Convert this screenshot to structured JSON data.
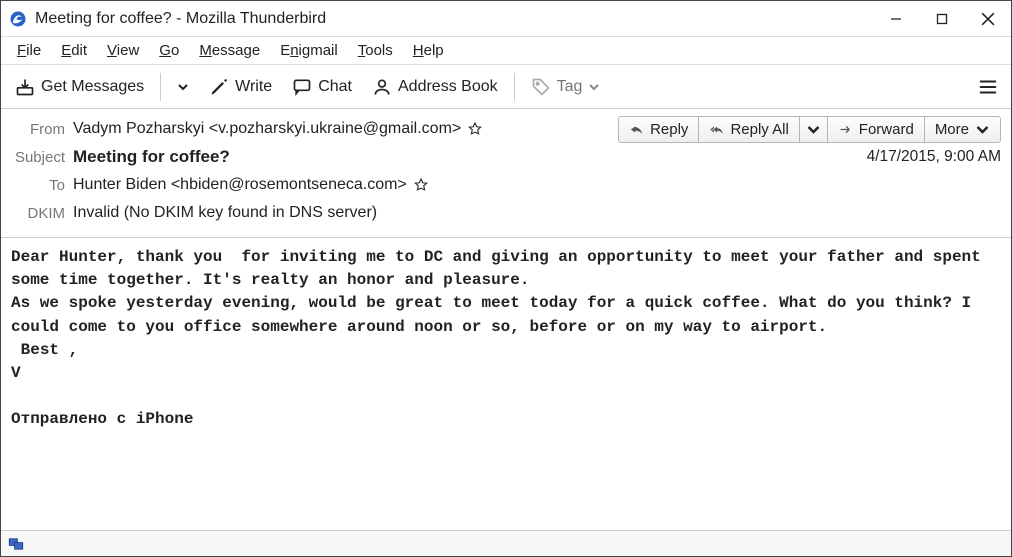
{
  "window": {
    "title": "Meeting for coffee? - Mozilla Thunderbird"
  },
  "menu": {
    "file": {
      "ul": "F",
      "rest": "ile"
    },
    "edit": {
      "ul": "E",
      "rest": "dit"
    },
    "view": {
      "ul": "V",
      "rest": "iew"
    },
    "go": {
      "ul": "G",
      "rest": "o"
    },
    "message": {
      "ul": "M",
      "rest": "essage"
    },
    "enigmail": {
      "ul": "n",
      "pre": "E",
      "rest": "igmail"
    },
    "tools": {
      "ul": "T",
      "rest": "ools"
    },
    "help": {
      "ul": "H",
      "rest": "elp"
    }
  },
  "toolbar": {
    "get_messages": "Get Messages",
    "write": "Write",
    "chat": "Chat",
    "address_book": "Address Book",
    "tag": "Tag"
  },
  "actions": {
    "reply": "Reply",
    "reply_all": "Reply All",
    "forward": "Forward",
    "more": "More"
  },
  "headers": {
    "from_label": "From",
    "from_value": "Vadym Pozharskyi <v.pozharskyi.ukraine@gmail.com>",
    "subject_label": "Subject",
    "subject_value": "Meeting for coffee?",
    "date_value": "4/17/2015, 9:00 AM",
    "to_label": "To",
    "to_value": "Hunter Biden <hbiden@rosemontseneca.com>",
    "dkim_label": "DKIM",
    "dkim_value": "Invalid (No DKIM key found in DNS server)"
  },
  "body": "Dear Hunter, thank you  for inviting me to DC and giving an opportunity to meet your father and spent some time together. It's realty an honor and pleasure.\nAs we spoke yesterday evening, would be great to meet today for a quick coffee. What do you think? I could come to you office somewhere around noon or so, before or on my way to airport.\n Best ,\nV\n\nОтправлено с iPhone"
}
